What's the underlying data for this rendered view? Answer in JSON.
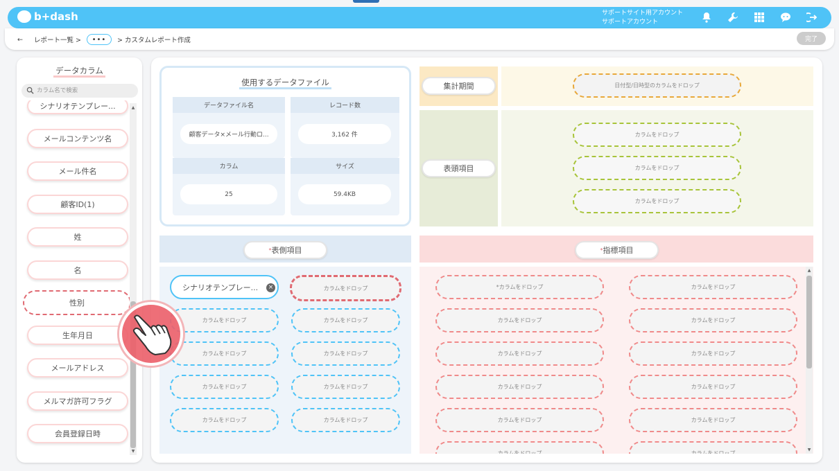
{
  "header": {
    "brand": "b+dash",
    "account_line1": "サポートサイト用アカウント",
    "account_line2": "サポートアカウント",
    "icons": [
      "bell-icon",
      "wrench-icon",
      "grid-icon",
      "chat-icon",
      "logout-icon"
    ]
  },
  "breadcrumb": {
    "back": "←",
    "item1": "レポート一覧 >",
    "ellipsis": "•••",
    "current": "> カスタムレポート作成",
    "done": "完了"
  },
  "sidebar": {
    "title": "データカラム",
    "search_placeholder": "カラム名で検索",
    "items": [
      "シナリオテンプレー...",
      "メールコンテンツ名",
      "メール件名",
      "顧客ID(1)",
      "姓",
      "名",
      "性別",
      "生年月日",
      "メールアドレス",
      "メルマガ許可フラグ",
      "会員登録日時"
    ],
    "selected": "性別"
  },
  "datafile": {
    "title": "使用するデータファイル",
    "h_file": "データファイル名",
    "h_records": "レコード数",
    "v_file": "顧客データ×メール行動ロ...",
    "v_records": "3,162 件",
    "h_columns": "カラム",
    "h_size": "サイズ",
    "v_columns": "25",
    "v_size": "59.4KB"
  },
  "period": {
    "label": "集計期間",
    "drop": "日付型/日時型のカラムをドロップ"
  },
  "headerItems": {
    "label": "表頭項目",
    "drop": "カラムをドロップ"
  },
  "rowItems": {
    "label": "表側項目",
    "required_mark": "*",
    "filled": "シナリオテンプレー...",
    "remove": "×",
    "drop": "カラムをドロップ"
  },
  "metrics": {
    "label": "指標項目",
    "required_mark": "*",
    "drop": "カラムをドロップ",
    "drop_first": "*カラムをドロップ"
  },
  "colors": {
    "brand": "#4fc3f7",
    "selected_dash": "#e06a72",
    "period_bg": "#fce9c4",
    "header_bg": "#e7ecd8",
    "rows_bg": "#eef4fa",
    "metrics_bg": "#fdf0f0"
  }
}
